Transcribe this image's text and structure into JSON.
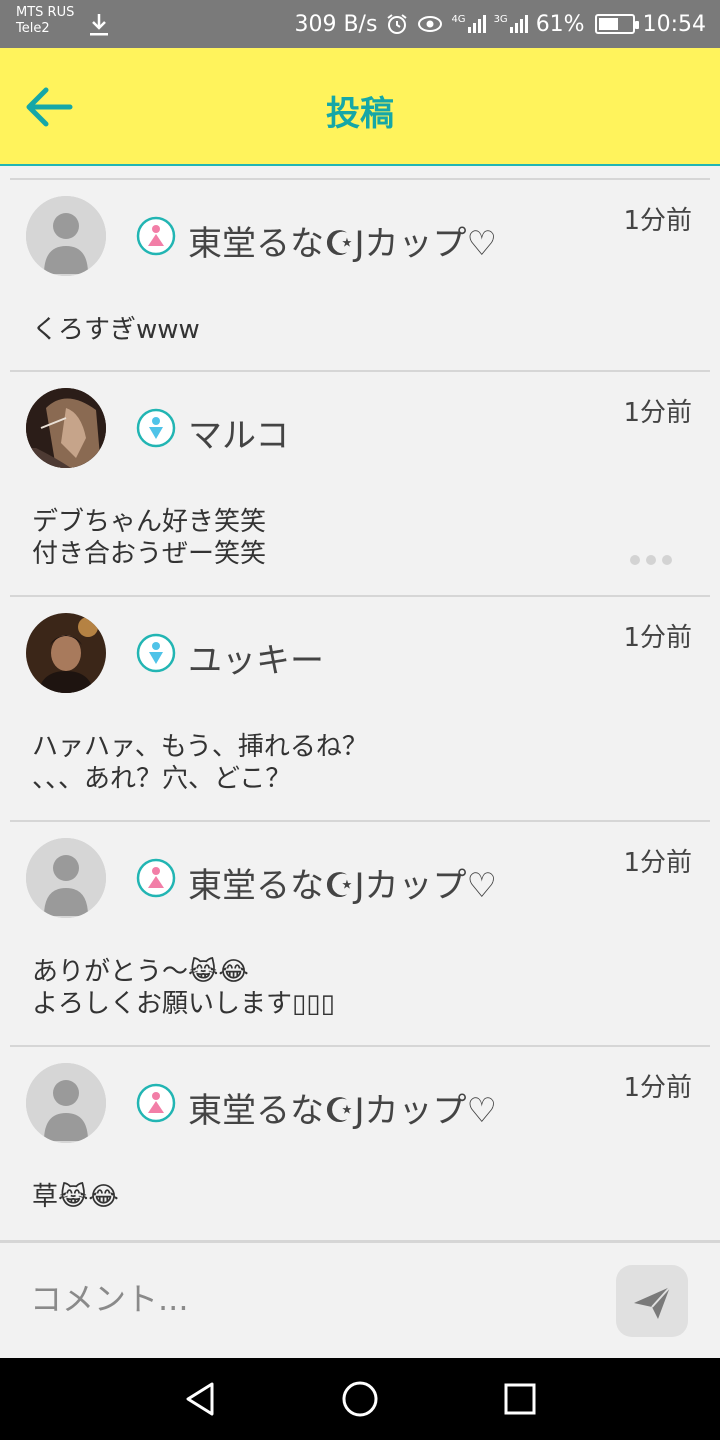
{
  "status_bar": {
    "carrier_line1": "MTS RUS",
    "carrier_line2": "Tele2",
    "net_speed": "309 B/s",
    "net_4g": "4G",
    "net_3g": "3G",
    "battery_percent": "61%",
    "battery_level": 0.61,
    "time": "10:54"
  },
  "app_bar": {
    "title": "投稿",
    "accent_color": "#15a7a7",
    "background_color": "#fff35c"
  },
  "posts": [
    {
      "username": "東堂るな☪Jカップ♡",
      "gender": "female",
      "avatar": "default-avatar",
      "time": "1分前",
      "body": "くろすぎwww",
      "has_more": false
    },
    {
      "username": "マルコ",
      "gender": "male",
      "avatar": "photo-avatar",
      "time": "1分前",
      "body": "デブちゃん好き笑笑\n付き合おうぜー笑笑",
      "has_more": true
    },
    {
      "username": "ユッキー",
      "gender": "male",
      "avatar": "photo-avatar",
      "time": "1分前",
      "body": "ハァハァ、もう、挿れるね？\n、、、あれ？穴、どこ？",
      "has_more": false
    },
    {
      "username": "東堂るな☪Jカップ♡",
      "gender": "female",
      "avatar": "default-avatar",
      "time": "1分前",
      "body": "ありがとう〜😹😂\nよろしくお願いします▯▯▯",
      "has_more": false
    },
    {
      "username": "東堂るな☪Jカップ♡",
      "gender": "female",
      "avatar": "default-avatar",
      "time": "1分前",
      "body": "草😹😂",
      "has_more": false
    }
  ],
  "comment_bar": {
    "placeholder": "コメント..."
  }
}
